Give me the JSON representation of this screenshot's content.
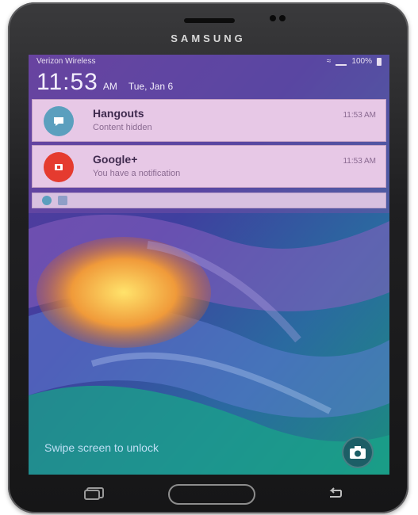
{
  "device": {
    "brand": "SAMSUNG"
  },
  "status_bar": {
    "carrier": "Verizon Wireless",
    "battery_text": "100%"
  },
  "lock_clock": {
    "time": "11:53",
    "ampm": "AM",
    "date": "Tue, Jan 6"
  },
  "notifications": [
    {
      "app": "Hangouts",
      "text": "Content hidden",
      "time": "11:53 AM",
      "icon": "hangouts-icon",
      "color": "#5b9fbe"
    },
    {
      "app": "Google+",
      "text": "You have a notification",
      "time": "11:53 AM",
      "icon": "google-plus-icon",
      "color": "#e53b2f"
    }
  ],
  "mini_bar_icons": [
    "hangouts-small-icon",
    "image-small-icon"
  ],
  "lock_screen": {
    "unlock_hint": "Swipe screen to unlock"
  },
  "softkeys": {
    "recent": "recent-apps-icon",
    "home": "home-button",
    "back": "back-icon"
  },
  "colors": {
    "notification_bg": "#e7c8e6",
    "camera_button": "#1c5e66",
    "accent": "#3c2f7a"
  }
}
